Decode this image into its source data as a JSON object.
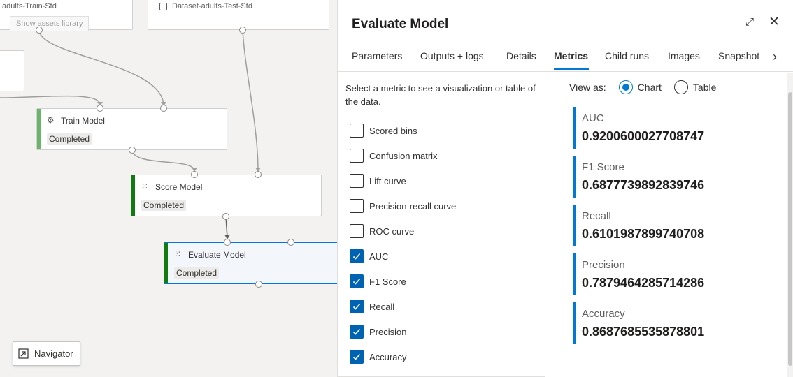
{
  "canvas": {
    "dataset_train_label": "adults-Train-Std",
    "dataset_test_label": "Dataset-adults-Test-Std",
    "show_assets_label": "Show assets library",
    "nodes": [
      {
        "title": "Train Model",
        "status": "Completed",
        "bar_color": "#6bb56b"
      },
      {
        "title": "Score Model",
        "status": "Completed",
        "bar_color": "#107c10"
      },
      {
        "title": "Evaluate Model",
        "status": "Completed",
        "bar_color": "#107c10"
      }
    ],
    "navigator_label": "Navigator"
  },
  "panel": {
    "title": "Evaluate Model",
    "tabs": [
      "Parameters",
      "Outputs + logs",
      "Details",
      "Metrics",
      "Child runs",
      "Images",
      "Snapshot"
    ],
    "active_tab": "Metrics",
    "selector_intro": "Select a metric to see a visualization or table of the data.",
    "metric_options": [
      {
        "label": "Scored bins",
        "checked": false
      },
      {
        "label": "Confusion matrix",
        "checked": false
      },
      {
        "label": "Lift curve",
        "checked": false
      },
      {
        "label": "Precision-recall curve",
        "checked": false
      },
      {
        "label": "ROC curve",
        "checked": false
      },
      {
        "label": "AUC",
        "checked": true
      },
      {
        "label": "F1 Score",
        "checked": true
      },
      {
        "label": "Recall",
        "checked": true
      },
      {
        "label": "Precision",
        "checked": true
      },
      {
        "label": "Accuracy",
        "checked": true
      }
    ],
    "view_as_label": "View as:",
    "view_options": [
      {
        "label": "Chart",
        "selected": true
      },
      {
        "label": "Table",
        "selected": false
      }
    ],
    "metrics": [
      {
        "name": "AUC",
        "value": "0.9200600027708747"
      },
      {
        "name": "F1 Score",
        "value": "0.6877739892839746"
      },
      {
        "name": "Recall",
        "value": "0.6101987899740708"
      },
      {
        "name": "Precision",
        "value": "0.7879464285714286"
      },
      {
        "name": "Accuracy",
        "value": "0.8687685535878801"
      }
    ],
    "accent_color": "#0078d4"
  }
}
